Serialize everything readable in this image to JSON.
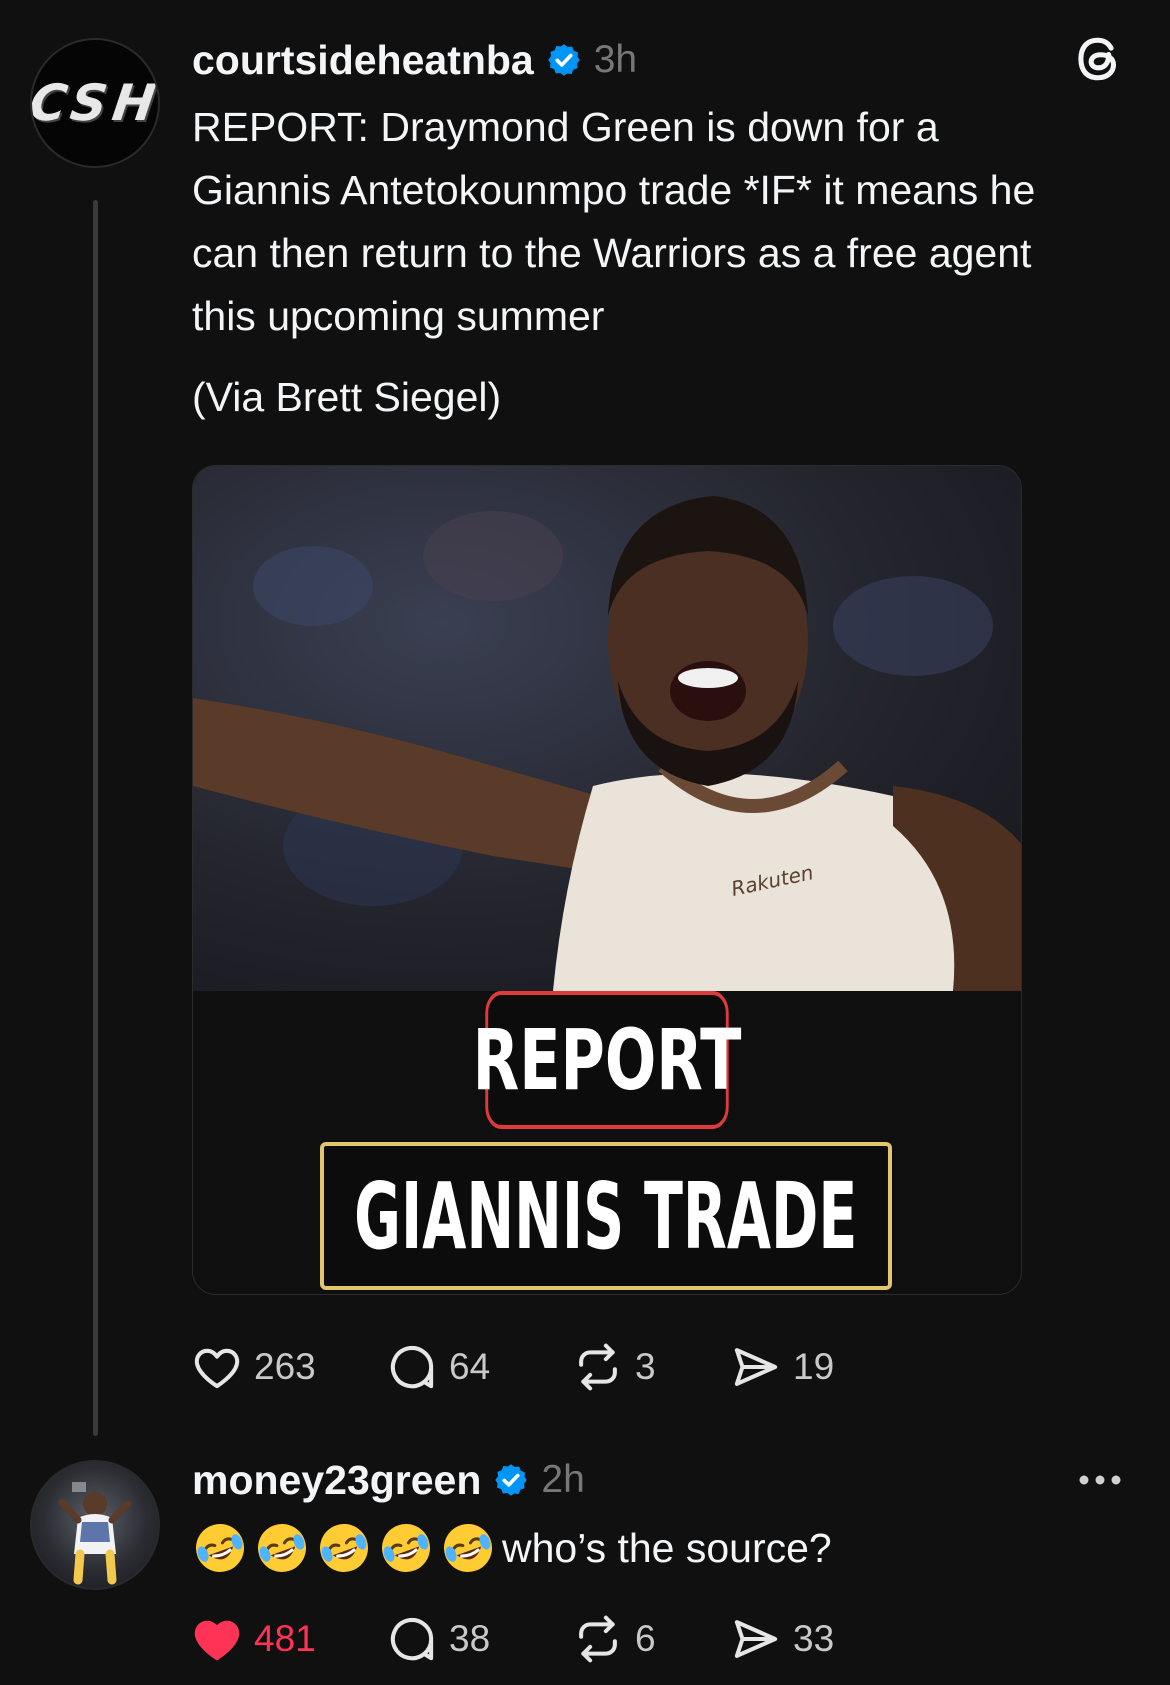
{
  "post": {
    "avatar_text": "CSH",
    "username": "courtsideheatnba",
    "verified_icon": "verified-badge-icon",
    "timestamp": "3h",
    "text_lines": [
      "REPORT: Draymond Green is down for a",
      "Giannis Antetokounmpo trade *IF* it means he",
      "can then return to the Warriors as a free agent",
      "this upcoming summer"
    ],
    "via": "(Via Brett Siegel)",
    "media": {
      "badge_top": "REPORT",
      "badge_bottom": "GIANNIS TRADE",
      "jersey_text": "Rakuten"
    },
    "actions": {
      "likes": "263",
      "replies": "64",
      "reposts": "3",
      "shares": "19"
    }
  },
  "reply": {
    "username": "money23green",
    "timestamp": "2h",
    "emoji_count": 5,
    "text": "who’s the source?",
    "actions": {
      "likes": "481",
      "replies": "38",
      "reposts": "6",
      "shares": "33"
    },
    "liked": true
  },
  "colors": {
    "background": "#101010",
    "verified": "#0095f6",
    "like_active": "#fe3355",
    "report_border": "#e03a3a",
    "trade_border": "#e3c56a"
  }
}
